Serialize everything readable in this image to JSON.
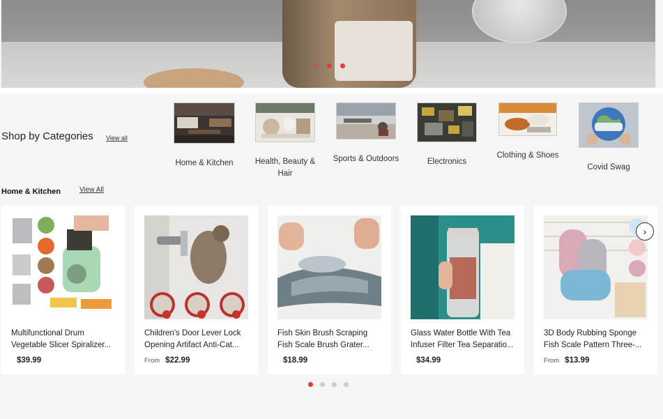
{
  "hero": {
    "slides": 3,
    "active_slide": 1
  },
  "categories": {
    "title": "Shop by Categories",
    "view_all": "View all",
    "items": [
      {
        "label": "Home & Kitchen"
      },
      {
        "label": "Health, Beauty & Hair"
      },
      {
        "label": "Sports & Outdoors"
      },
      {
        "label": "Electronics"
      },
      {
        "label": "Clothing & Shoes"
      },
      {
        "label": "Covid Swag"
      }
    ]
  },
  "section": {
    "title": "Home & Kitchen",
    "view_all": "View All"
  },
  "products": [
    {
      "title1": "Multifunctional Drum",
      "title2": "Vegetable Slicer Spiralizer...",
      "from": "",
      "price": "$39.99"
    },
    {
      "title1": "Children's Door Lever Lock",
      "title2": "Opening Artifact Anti-Cat...",
      "from": "From",
      "price": "$22.99"
    },
    {
      "title1": "Fish Skin Brush Scraping",
      "title2": "Fish Scale Brush Grater...",
      "from": "",
      "price": "$18.99"
    },
    {
      "title1": "Glass Water Bottle With Tea",
      "title2": "Infuser Filter Tea Separatio...",
      "from": "",
      "price": "$34.99"
    },
    {
      "title1": "3D Body Rubbing Sponge",
      "title2": "Fish Scale Pattern Three-...",
      "from": "From",
      "price": "$13.99"
    }
  ],
  "carousel": {
    "pages": 4,
    "active_page": 0
  },
  "icons": {
    "next": "chevron-right-icon"
  },
  "colors": {
    "accent": "#e23b3b",
    "card_bg": "#ffffff",
    "page_bg": "#f5f5f5"
  }
}
